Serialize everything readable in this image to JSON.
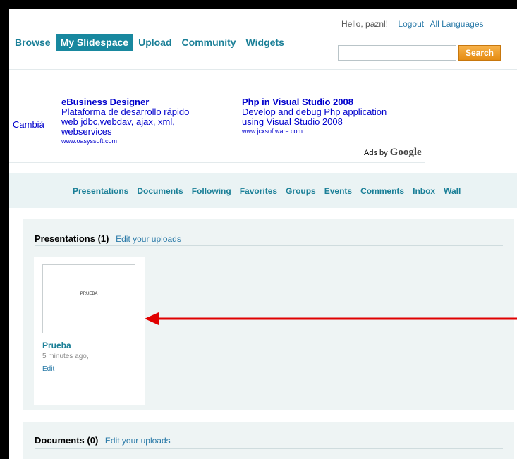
{
  "header": {
    "greeting": "Hello,  paznl!",
    "logout": "Logout",
    "languages": "All Languages",
    "search_button": "Search",
    "search_value": ""
  },
  "nav": {
    "items": [
      {
        "label": "Browse",
        "active": false
      },
      {
        "label": "My Slidespace",
        "active": true
      },
      {
        "label": "Upload",
        "active": false
      },
      {
        "label": "Community",
        "active": false
      },
      {
        "label": "Widgets",
        "active": false
      }
    ]
  },
  "ads": {
    "cut_text": "Cambiá",
    "items": [
      {
        "title": "eBusiness Designer",
        "lines": [
          "Plataforma de desarrollo rápido",
          "web jdbc,webdav, ajax, xml,",
          "webservices"
        ],
        "url": "www.oasyssoft.com"
      },
      {
        "title": "Php in Visual Studio 2008",
        "lines": [
          "Develop and debug Php application",
          "using Visual Studio 2008"
        ],
        "url": "www.jcxsoftware.com"
      }
    ],
    "ads_by": "Ads by",
    "google": "Google"
  },
  "subnav": {
    "items": [
      "Presentations",
      "Documents",
      "Following",
      "Favorites",
      "Groups",
      "Events",
      "Comments",
      "Inbox",
      "Wall"
    ]
  },
  "presentations": {
    "title": "Presentations (1)",
    "edit_link": "Edit your uploads",
    "items": [
      {
        "thumb_text": "PRUEBA",
        "title": "Prueba",
        "time": "5 minutes ago,",
        "edit": "Edit"
      }
    ]
  },
  "documents": {
    "title": "Documents (0)",
    "edit_link": "Edit your uploads"
  },
  "colors": {
    "accent": "#18889f",
    "link": "#1a7f97",
    "search_button": "#e58c12",
    "annotation_arrow": "#e00000"
  }
}
